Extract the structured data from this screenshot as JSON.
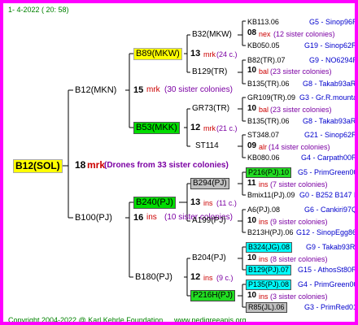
{
  "header": {
    "date": "1-   4-2022  ( 20:  58)"
  },
  "root": {
    "label": "B12(SOL)",
    "number": "18",
    "code": "mrk",
    "note": "(Drones from 33 sister colonies)"
  },
  "gen1": [
    {
      "label": "B12(MKN)",
      "number": "15",
      "code": "mrk",
      "note": "(30 sister colonies)"
    },
    {
      "label": "B100(PJ)",
      "number": "16",
      "code": "ins",
      "note": "(10 sister colonies)"
    }
  ],
  "gen2": [
    {
      "label": "B89(MKW)",
      "number": "13",
      "code": "mrk",
      "note": "(24 c.)"
    },
    {
      "label": "B53(MKK)",
      "number": "12",
      "code": "mrk",
      "note": "(21 c.)"
    },
    {
      "label": "B240(PJ)",
      "number": "13",
      "code": "ins",
      "note": "(11 c.)"
    },
    {
      "label": "B180(PJ)",
      "number": "12",
      "code": "ins",
      "note": "(9 c.)"
    }
  ],
  "gen3": [
    {
      "label": "B32(MKW)",
      "number": "08",
      "code": "nex",
      "note": "(12 sister colonies)"
    },
    {
      "label": "B129(TR)",
      "number": "10",
      "code": "bal",
      "note": "(23 sister colonies)"
    },
    {
      "label": "GR73(TR)",
      "number": "10",
      "code": "bal",
      "note": "(23 sister colonies)"
    },
    {
      "label": "ST114",
      "number": "09",
      "code": "alr",
      "note": "(14 sister colonies)"
    },
    {
      "label": "B294(PJ)",
      "number": "11",
      "code": "ins",
      "note": "(7 sister colonies)"
    },
    {
      "label": "A199(PJ)",
      "number": "10",
      "code": "ins",
      "note": "(9 sister colonies)"
    },
    {
      "label": "B204(PJ)",
      "number": "10",
      "code": "ins",
      "note": "(8 sister colonies)"
    },
    {
      "label": "P216H(PJ)",
      "number": "10",
      "code": "ins",
      "note": "(3 sister colonies)"
    }
  ],
  "gen4": [
    {
      "label": "KB113.06",
      "ref": "G5 - Sinop96R"
    },
    {
      "label": "KB050.05",
      "ref": "G19 - Sinop62R"
    },
    {
      "label": "B82(TR).07",
      "ref": "G9 - NO6294R"
    },
    {
      "label": "B135(TR).06",
      "ref": "G8 - Takab93aR"
    },
    {
      "label": "GR109(TR).09",
      "ref": "G3 - Gr.R.mounta"
    },
    {
      "label": "B135(TR).06",
      "ref": "G8 - Takab93aR"
    },
    {
      "label": "ST348.07",
      "ref": "G21 - Sinop62R"
    },
    {
      "label": "KB080.06",
      "ref": "G4 - Carpath00R"
    },
    {
      "label": "P216(PJ).10",
      "ref": "G5 - PrimGreen00"
    },
    {
      "label": "Bmix11(PJ).09",
      "ref": "G0 - B252 B147 B"
    },
    {
      "label": "A6(PJ).08",
      "ref": "G6 - Cankiri97Q"
    },
    {
      "label": "B213H(PJ).06",
      "ref": "G12 - SinopEgg86R"
    },
    {
      "label": "B324(JG).08",
      "ref": "G9 - Takab93R"
    },
    {
      "label": "B129(PJ).07",
      "ref": "G15 - AthosSt80R"
    },
    {
      "label": "P135(PJ).08",
      "ref": "G4 - PrimGreen00"
    },
    {
      "label": "R85(JL).06",
      "ref": "G3 - PrimRed01"
    }
  ],
  "footer": {
    "copyright": "Copyright 2004-2022 @ Karl Kehrle Foundation",
    "site": "www.pedigreeapis.org"
  }
}
